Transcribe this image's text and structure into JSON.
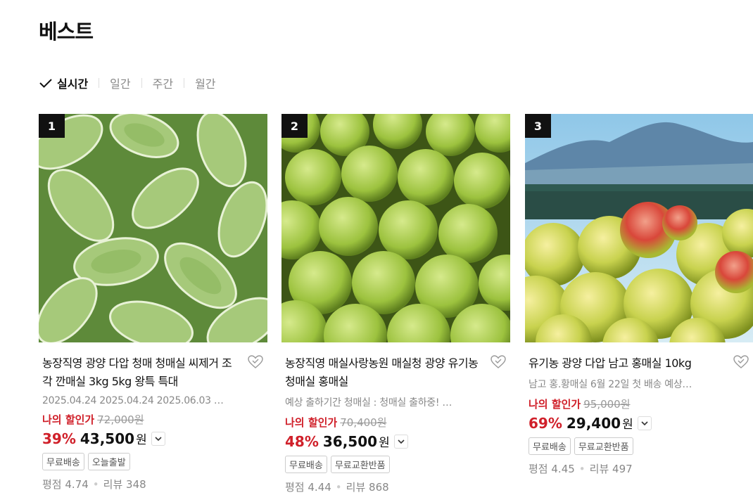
{
  "page": {
    "title": "베스트"
  },
  "tabs": [
    {
      "label": "실시간",
      "active": true
    },
    {
      "label": "일간",
      "active": false
    },
    {
      "label": "주간",
      "active": false
    },
    {
      "label": "월간",
      "active": false
    }
  ],
  "products": [
    {
      "rank": "1",
      "name": "농장직영 광양 다압 청매 청매실 씨제거 조각 깐매실 3kg 5kg 왕특 특대",
      "desc": "2025.04.24 2025.04.24 2025.06.03 …",
      "my_price_label": "나의 할인가",
      "orig_price": "72,000원",
      "rate": "39%",
      "price": "43,500",
      "won": "원",
      "badges": [
        "무료배송",
        "오늘출발"
      ],
      "rating_label": "평점",
      "rating": "4.74",
      "review_label": "리뷰",
      "reviews": "348"
    },
    {
      "rank": "2",
      "name": "농장직영 매실사랑농원 매실청 광양 유기농 청매실 홍매실",
      "desc": "예상 출하기간 청매실 : 청매실 출하중! …",
      "my_price_label": "나의 할인가",
      "orig_price": "70,400원",
      "rate": "48%",
      "price": "36,500",
      "won": "원",
      "badges": [
        "무료배송",
        "무료교환반품"
      ],
      "rating_label": "평점",
      "rating": "4.44",
      "review_label": "리뷰",
      "reviews": "868"
    },
    {
      "rank": "3",
      "name": "유기농 광양 다압 남고 홍매실 10kg",
      "desc": "남고 홍.황매실 6월 22일 첫 배송 예상…",
      "my_price_label": "나의 할인가",
      "orig_price": "95,000원",
      "rate": "69%",
      "price": "29,400",
      "won": "원",
      "badges": [
        "무료배송",
        "무료교환반품"
      ],
      "rating_label": "평점",
      "rating": "4.45",
      "review_label": "리뷰",
      "reviews": "497"
    }
  ],
  "colors": {
    "accent": "#d0202a",
    "rank_bg": "#111111"
  }
}
